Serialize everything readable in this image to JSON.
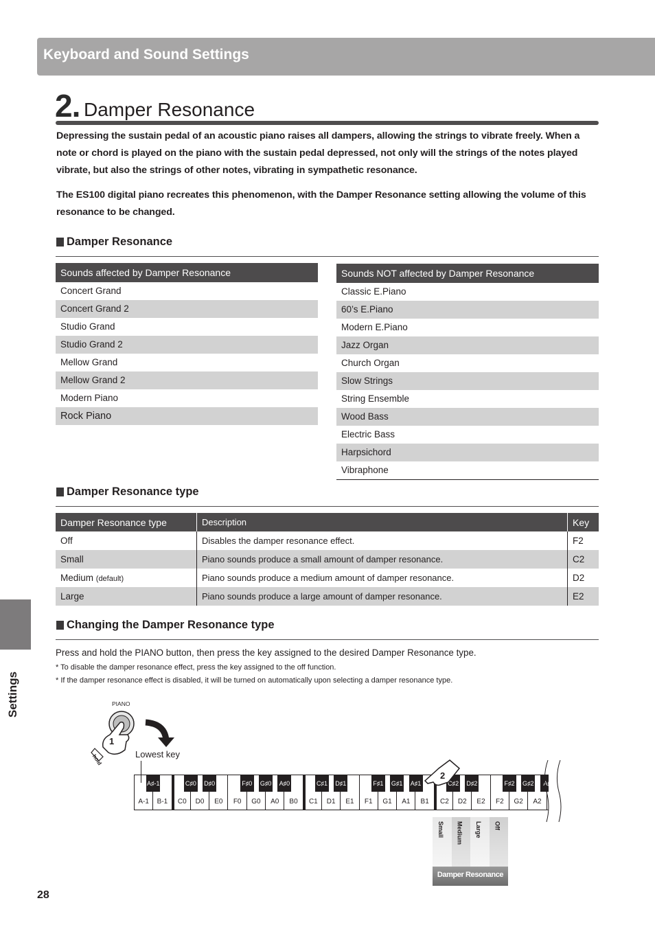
{
  "header": {
    "title": "Keyboard and Sound Settings"
  },
  "section": {
    "number": "2.",
    "title": "Damper Resonance",
    "intro_paragraph_1": "Depressing the sustain pedal of an acoustic piano raises all dampers, allowing the strings to vibrate freely. When a note or chord is played on the piano with the sustain pedal depressed, not only will the strings of the notes played vibrate, but also the strings of other notes, vibrating in sympathetic resonance.",
    "intro_paragraph_2": "The ES100 digital piano recreates this phenomenon, with the Damper Resonance setting allowing the volume of this resonance to be changed."
  },
  "damper_resonance": {
    "heading": "Damper Resonance",
    "affected": {
      "header": "Sounds affected by Damper Resonance",
      "items": [
        "Concert Grand",
        "Concert Grand 2",
        "Studio Grand",
        "Studio Grand 2",
        "Mellow Grand",
        "Mellow Grand 2",
        "Modern Piano",
        "Rock Piano"
      ]
    },
    "not_affected": {
      "header": "Sounds NOT affected by Damper Resonance",
      "items": [
        "Classic E.Piano",
        "60’s E.Piano",
        "Modern E.Piano",
        "Jazz Organ",
        "Church Organ",
        "Slow Strings",
        "String Ensemble",
        "Wood Bass",
        "Electric Bass",
        "Harpsichord",
        "Vibraphone"
      ]
    }
  },
  "type_table": {
    "heading": "Damper Resonance type",
    "columns": [
      "Damper Resonance type",
      "Description",
      "Key"
    ],
    "rows": [
      {
        "type": "Off",
        "note": "",
        "description": "Disables the damper resonance effect.",
        "key": "F2"
      },
      {
        "type": "Small",
        "note": "",
        "description": "Piano sounds produce a small amount of damper resonance.",
        "key": "C2"
      },
      {
        "type": "Medium",
        "note": "(default)",
        "description": "Piano sounds produce a medium amount of damper resonance.",
        "key": "D2"
      },
      {
        "type": "Large",
        "note": "",
        "description": "Piano sounds produce a large amount of damper resonance.",
        "key": "E2"
      }
    ]
  },
  "changing": {
    "heading": "Changing the Damper Resonance type",
    "instruction": "Press and hold the PIANO button, then press the key assigned to the desired Damper Resonance type.",
    "notes": [
      "* To disable the damper resonance effect, press the key assigned to the off function.",
      "* If the damper resonance effect is disabled, it will be turned on automatically upon selecting a damper resonance type."
    ]
  },
  "diagram": {
    "button_label": "PIANO",
    "step1": "1",
    "step2": "2",
    "hold_label": "hold",
    "lowest_key_label": "Lowest key",
    "white_keys": [
      "A-1",
      "B-1",
      "C0",
      "D0",
      "E0",
      "F0",
      "G0",
      "A0",
      "B0",
      "C1",
      "D1",
      "E1",
      "F1",
      "G1",
      "A1",
      "B1",
      "C2",
      "D2",
      "E2",
      "F2",
      "G2",
      "A2"
    ],
    "black_keys": [
      "A♯-1",
      "C♯0",
      "D♯0",
      "F♯0",
      "G♯0",
      "A♯0",
      "C♯1",
      "D♯1",
      "F♯1",
      "G♯1",
      "A♯1",
      "C♯2",
      "D♯2",
      "F♯2",
      "G♯2",
      "A♯"
    ],
    "panel_options": [
      "Small",
      "Medium",
      "Large",
      "Off"
    ],
    "panel_label": "Damper Resonance"
  },
  "side_tab": {
    "label": "Settings"
  },
  "page_number": "28"
}
